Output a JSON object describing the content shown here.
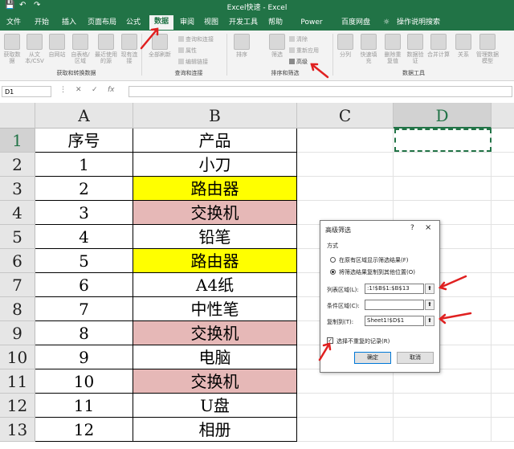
{
  "titlebar": {
    "title": "Excel快速  -  Excel",
    "save_icon": "floppy-icon",
    "undo_icon": "undo-icon",
    "redo_icon": "redo-icon"
  },
  "tabs": [
    {
      "label": "文件"
    },
    {
      "label": "开始"
    },
    {
      "label": "插入"
    },
    {
      "label": "页面布局"
    },
    {
      "label": "公式"
    },
    {
      "label": "数据",
      "active": true
    },
    {
      "label": "审阅"
    },
    {
      "label": "视图"
    },
    {
      "label": "开发工具"
    },
    {
      "label": "帮助"
    },
    {
      "label": "Power Pivot"
    },
    {
      "label": "百度网盘"
    },
    {
      "label": "操作说明搜索"
    }
  ],
  "ribbon": {
    "get_buttons": [
      "获取数据",
      "从文本/CSV",
      "自网站",
      "自表格/区域",
      "最近使用的源",
      "现有连接"
    ],
    "refresh": "全部刷新",
    "query_items": [
      "查询和连接",
      "属性",
      "编辑链接"
    ],
    "sort_filter": [
      "排序",
      "筛选"
    ],
    "filter_items": [
      "清除",
      "重新应用",
      "高级"
    ],
    "tools": [
      "分列",
      "快速填充",
      "删除重复值",
      "数据验证",
      "合并计算",
      "关系",
      "管理数据模型"
    ],
    "groups": [
      "获取和转换数据",
      "查询和连接",
      "排序和筛选",
      "数据工具"
    ]
  },
  "formula_bar": {
    "name_box": "D1",
    "fx": "fx",
    "value": ""
  },
  "sheet": {
    "columns": [
      "A",
      "B",
      "C",
      "D"
    ],
    "rows": [
      {
        "num": "1",
        "a": "序号",
        "b": "产品",
        "fill": ""
      },
      {
        "num": "2",
        "a": "1",
        "b": "小刀",
        "fill": ""
      },
      {
        "num": "3",
        "a": "2",
        "b": "路由器",
        "fill": "yellow"
      },
      {
        "num": "4",
        "a": "3",
        "b": "交换机",
        "fill": "pink"
      },
      {
        "num": "5",
        "a": "4",
        "b": "铅笔",
        "fill": ""
      },
      {
        "num": "6",
        "a": "5",
        "b": "路由器",
        "fill": "yellow"
      },
      {
        "num": "7",
        "a": "6",
        "b": "A4纸",
        "fill": ""
      },
      {
        "num": "8",
        "a": "7",
        "b": "中性笔",
        "fill": ""
      },
      {
        "num": "9",
        "a": "8",
        "b": "交换机",
        "fill": "pink"
      },
      {
        "num": "10",
        "a": "9",
        "b": "电脑",
        "fill": ""
      },
      {
        "num": "11",
        "a": "10",
        "b": "交换机",
        "fill": "pink"
      },
      {
        "num": "12",
        "a": "11",
        "b": "U盘",
        "fill": ""
      },
      {
        "num": "13",
        "a": "12",
        "b": "相册",
        "fill": ""
      }
    ]
  },
  "dialog": {
    "title": "高级筛选",
    "help": "?",
    "close": "×",
    "mode_label": "方式",
    "radio1": "在原有区域显示筛选结果(F)",
    "radio2": "将筛选结果复制到其他位置(O)",
    "list_label": "列表区域(L):",
    "list_value": ":1!$B$1:$B$13",
    "criteria_label": "条件区域(C):",
    "criteria_value": "",
    "copy_label": "复制到(T):",
    "copy_value": "Sheet1!$D$1",
    "unique_label": "选择不重复的记录(R)",
    "unique_checked": true,
    "ok": "确定",
    "cancel": "取消",
    "picker_icon": "range-picker-icon"
  },
  "colors": {
    "excel_green": "#217346",
    "yellow": "#ffff00",
    "pink": "#e6b8b7",
    "arrow_red": "#e02020"
  }
}
